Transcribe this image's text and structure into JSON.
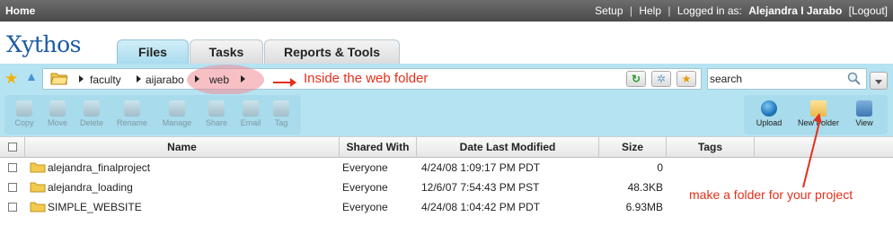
{
  "topbar": {
    "home": "Home",
    "setup": "Setup",
    "sep1": "|",
    "help": "Help",
    "sep2": "|",
    "logged_in_as": "Logged in as:",
    "user_name": "Alejandra I Jarabo",
    "logout": "[Logout]"
  },
  "logo": "Xythos",
  "tabs": [
    {
      "label": "Files",
      "active": true
    },
    {
      "label": "Tasks",
      "active": false
    },
    {
      "label": "Reports & Tools",
      "active": false
    }
  ],
  "path": {
    "crumbs": [
      "faculty",
      "aijarabo",
      "web"
    ],
    "annotation": "Inside the web folder"
  },
  "search": {
    "value": "search"
  },
  "toolbar": {
    "left_tools": [
      "Copy",
      "Move",
      "Delete",
      "Rename",
      "Manage",
      "Share",
      "Email",
      "Tag"
    ],
    "right_tools": [
      "Upload",
      "New Folder",
      "View"
    ]
  },
  "annotation_folder": "make a folder for your project",
  "table": {
    "headers": [
      "Name",
      "Shared With",
      "Date Last Modified",
      "Size",
      "Tags"
    ],
    "rows": [
      {
        "name": "alejandra_finalproject",
        "shared": "Everyone",
        "date": "4/24/08 1:09:17 PM PDT",
        "size": "0"
      },
      {
        "name": "alejandra_loading",
        "shared": "Everyone",
        "date": "12/6/07 7:54:43 PM PST",
        "size": "48.3KB"
      },
      {
        "name": "SIMPLE_WEBSITE",
        "shared": "Everyone",
        "date": "4/24/08 1:04:42 PM PDT",
        "size": "6.93MB"
      }
    ]
  },
  "colors": {
    "accent": "#b6e3f1",
    "annotation": "#e3301b",
    "logo": "#1b5aa6"
  }
}
